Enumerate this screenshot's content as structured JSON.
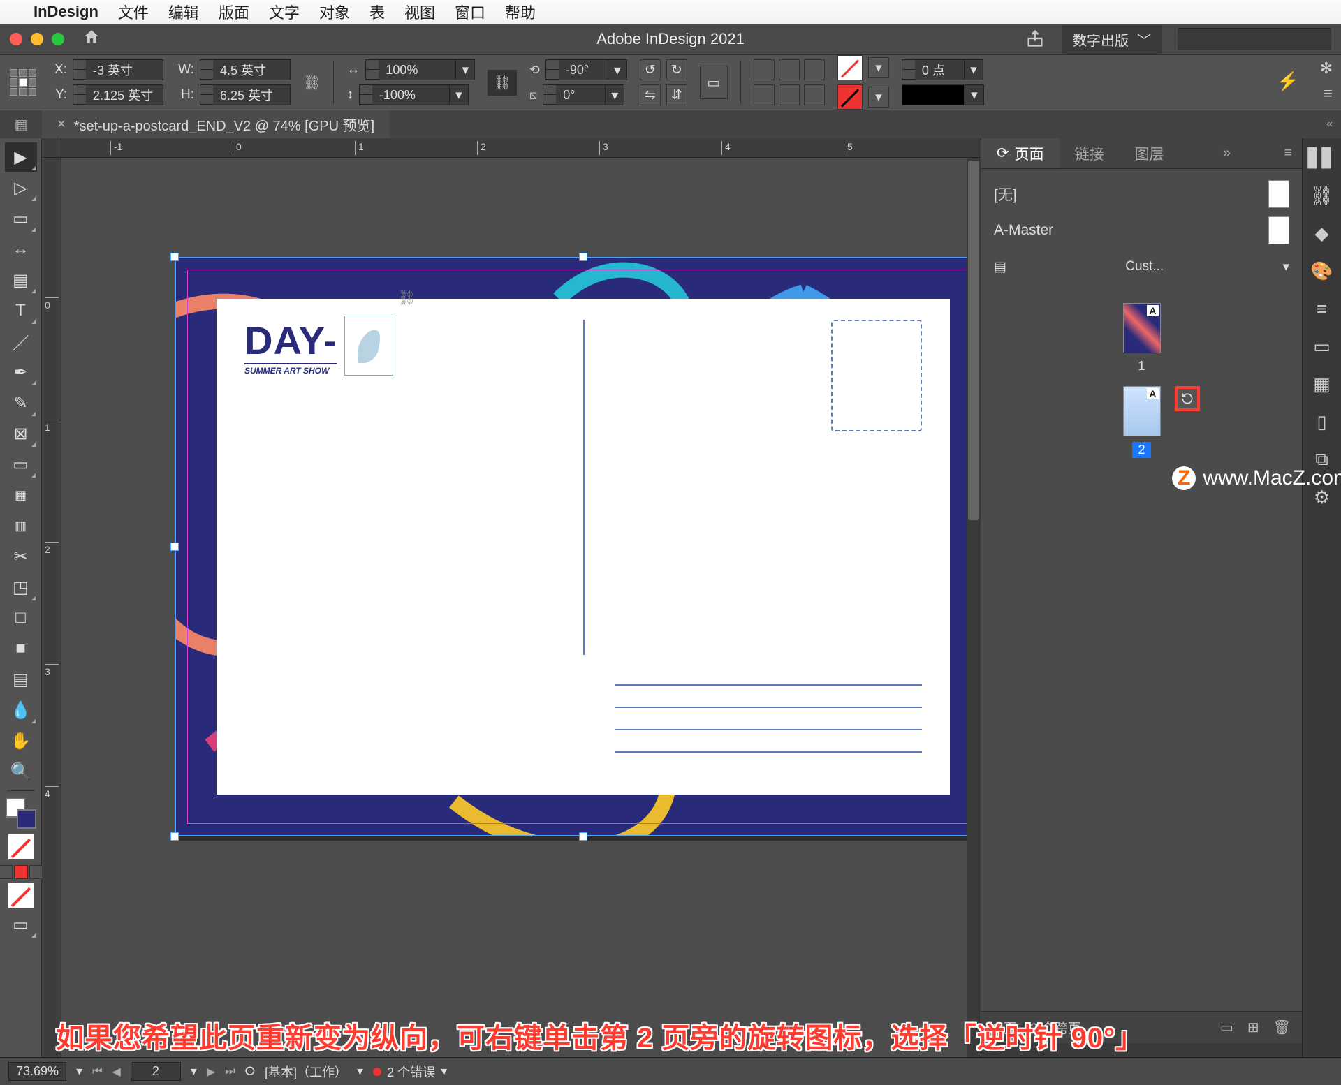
{
  "mac_menu": {
    "app": "InDesign",
    "items": [
      "文件",
      "编辑",
      "版面",
      "文字",
      "对象",
      "表",
      "视图",
      "窗口",
      "帮助"
    ]
  },
  "titlebar": {
    "title": "Adobe InDesign 2021",
    "workspace": "数字出版"
  },
  "control": {
    "x": "-3 英寸",
    "y": "2.125 英寸",
    "w": "4.5 英寸",
    "h": "6.25 英寸",
    "scale_x": "100%",
    "scale_y": "-100%",
    "rotate": "-90°",
    "shear": "0°",
    "stroke_pt": "0 点"
  },
  "doc_tab": "*set-up-a-postcard_END_V2 @ 74% [GPU 预览]",
  "ruler_h": [
    "-1",
    "0",
    "1",
    "2",
    "3",
    "4",
    "5"
  ],
  "ruler_v": [
    "0",
    "1",
    "2",
    "3",
    "4"
  ],
  "postcard": {
    "day": "DAY-",
    "sub": "SUMMER ART SHOW"
  },
  "panel": {
    "tabs": [
      "页面",
      "链接",
      "图层"
    ],
    "masters": {
      "none": "[无]",
      "amaster": "A-Master",
      "size_preset": "Cust..."
    },
    "pages": {
      "p1": "1",
      "p2": "2"
    },
    "footer": "2 页，2 个跨页"
  },
  "watermark": "www.MacZ.com",
  "status": {
    "zoom": "73.69%",
    "page": "2",
    "preflight_profile": "[基本]（工作）",
    "errors": "2 个错误"
  },
  "overlay": "如果您希望此页重新变为纵向，可右键单击第 2 页旁的旋转图标，选择「逆时针 90°」"
}
